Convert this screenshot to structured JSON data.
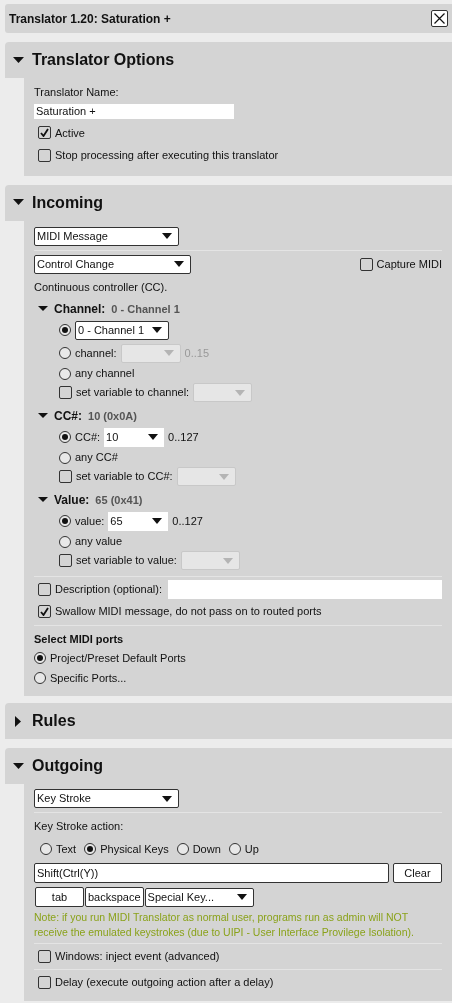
{
  "window": {
    "title": "Translator 1.20: Saturation +"
  },
  "options": {
    "title": "Translator Options",
    "expanded": true,
    "name_label": "Translator Name:",
    "name_value": "Saturation +",
    "checkboxes": [
      {
        "label": "Active",
        "checked": true
      },
      {
        "label": "Stop processing after executing this translator",
        "checked": false
      }
    ]
  },
  "incoming": {
    "title": "Incoming",
    "expanded": true,
    "type_select": "MIDI Message",
    "message_select": "Control Change",
    "capture": {
      "label": "Capture MIDI",
      "checked": false
    },
    "description": "Continuous controller (CC).",
    "groups": [
      {
        "title": "Channel:",
        "summary": "0 - Channel 1",
        "expanded": true,
        "rows": [
          {
            "kind": "radio_select",
            "selected": true,
            "value": "0 - Channel 1",
            "disabled": false
          },
          {
            "kind": "radio_select",
            "selected": false,
            "label": "channel:",
            "range": "0..15",
            "disabled": true
          },
          {
            "kind": "radio",
            "selected": false,
            "label": "any channel"
          },
          {
            "kind": "checkbox_select",
            "checked": false,
            "label": "set variable to channel:"
          }
        ]
      },
      {
        "title": "CC#:",
        "summary": "10 (0x0A)",
        "expanded": true,
        "rows": [
          {
            "kind": "radio_select",
            "selected": true,
            "label": "CC#:",
            "value": "10",
            "range": "0..127",
            "disabled": false
          },
          {
            "kind": "radio",
            "selected": false,
            "label": "any CC#"
          },
          {
            "kind": "checkbox_select",
            "checked": false,
            "label": "set variable to CC#:"
          }
        ]
      },
      {
        "title": "Value:",
        "summary": "65 (0x41)",
        "expanded": true,
        "rows": [
          {
            "kind": "radio_select",
            "selected": true,
            "label": "value:",
            "value": "65",
            "range": "0..127",
            "disabled": false
          },
          {
            "kind": "radio",
            "selected": false,
            "label": "any value"
          },
          {
            "kind": "checkbox_select",
            "checked": false,
            "label": "set variable to value:"
          }
        ]
      }
    ],
    "description_field": {
      "label": "Description (optional):",
      "checked": false
    },
    "swallow": {
      "label": "Swallow MIDI message, do not pass on to routed ports",
      "checked": true
    },
    "ports": {
      "title": "Select MIDI ports",
      "options": [
        {
          "label": "Project/Preset Default Ports",
          "selected": true
        },
        {
          "label": "Specific Ports...",
          "selected": false
        }
      ]
    }
  },
  "rules": {
    "title": "Rules",
    "expanded": false
  },
  "outgoing": {
    "title": "Outgoing",
    "expanded": true,
    "type_select": "Key Stroke",
    "action_label": "Key Stroke action:",
    "modes": [
      {
        "label": "Text",
        "selected": false
      },
      {
        "label": "Physical Keys",
        "selected": true
      },
      {
        "label": "Down",
        "selected": false
      },
      {
        "label": "Up",
        "selected": false
      }
    ],
    "keys_value": "Shift(Ctrl(Y))",
    "clear_button": "Clear",
    "key_buttons": [
      "tab",
      "backspace"
    ],
    "special_select": "Special Key...",
    "note": "Note: if you run MIDI Translator as normal user, programs run as admin will NOT receive the emulated keystrokes (due to UIPI - User Interface Provilege Isolation).",
    "checkboxes": [
      {
        "label": "Windows: inject event (advanced)",
        "checked": false
      },
      {
        "label": "Delay (execute outgoing action after a delay)",
        "checked": false
      }
    ]
  }
}
